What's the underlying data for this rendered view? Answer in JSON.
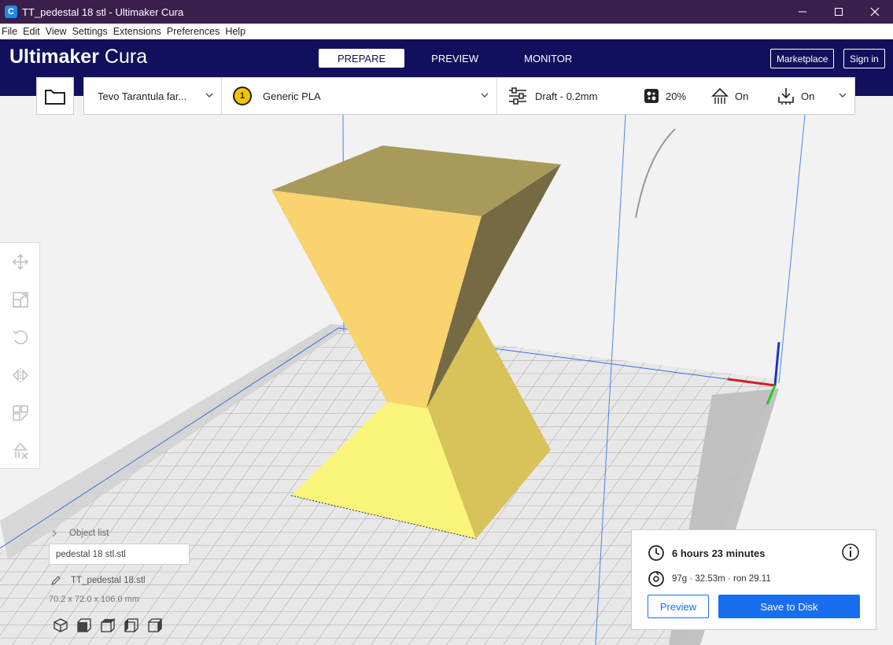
{
  "window": {
    "title": "TT_pedestal 18 stl - Ultimaker Cura",
    "app_icon": "C"
  },
  "menu": [
    "File",
    "Edit",
    "View",
    "Settings",
    "Extensions",
    "Preferences",
    "Help"
  ],
  "brand": {
    "name": "Ultimaker",
    "product": "Cura"
  },
  "stages": [
    "PREPARE",
    "PREVIEW",
    "MONITOR"
  ],
  "active_stage": "PREPARE",
  "header_buttons": {
    "marketplace": "Marketplace",
    "signin": "Sign in"
  },
  "toolbar": {
    "printer": "Tevo Tarantula far...",
    "extruder_number": "1",
    "material": "Generic PLA",
    "profile": "Draft - 0.2mm",
    "infill": "20%",
    "support": "On",
    "adhesion": "On"
  },
  "object_list": {
    "header": "Object list",
    "filename": "pedestal 18 stl.stl",
    "object_name": "TT_pedestal 18.stl",
    "dimensions": "70.2 x 72.0 x 106.0 mm"
  },
  "summary": {
    "time": "6 hours 23 minutes",
    "material": "97g · 32.53m · ron 29.11",
    "preview_label": "Preview",
    "save_label": "Save to Disk"
  },
  "colors": {
    "title_bar": "#3a1f4d",
    "header": "#12105c",
    "accent": "#196ef0",
    "model": "#f7d567"
  },
  "icons": {
    "tools": [
      "move-icon",
      "scale-icon",
      "rotate-icon",
      "mirror-icon",
      "per-model-settings-icon",
      "support-blocker-icon"
    ],
    "views": [
      "3d-view-icon",
      "front-view-icon",
      "top-view-icon",
      "left-view-icon",
      "right-view-icon"
    ]
  }
}
